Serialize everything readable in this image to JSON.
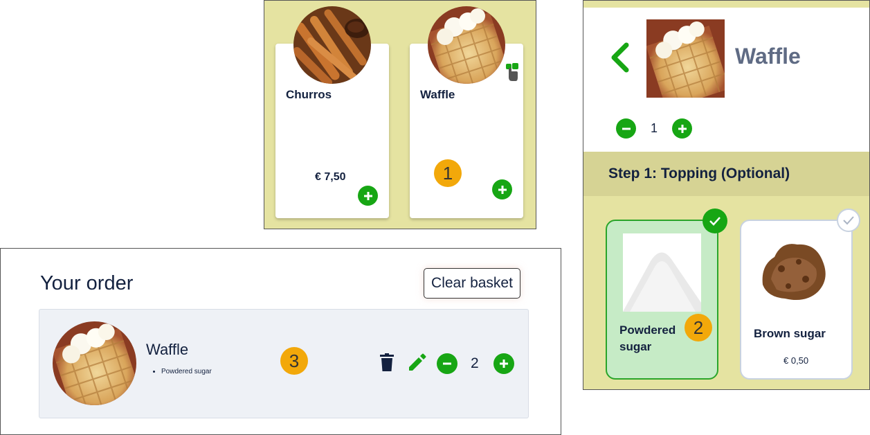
{
  "menu": {
    "items": [
      {
        "name": "Churros",
        "price": "€  7,50"
      },
      {
        "name": "Waffle",
        "price": ""
      }
    ],
    "badge": "1"
  },
  "detail": {
    "title": "Waffle",
    "quantity": "1",
    "step_label": "Step 1: Topping (Optional)",
    "toppings": [
      {
        "name_line1": "Powdered",
        "name_line2": "sugar",
        "price": "",
        "selected": true
      },
      {
        "name_line1": "Brown sugar",
        "name_line2": "",
        "price": "€ 0,50",
        "selected": false
      }
    ],
    "badge": "2"
  },
  "order": {
    "title": "Your order",
    "clear_label": "Clear basket",
    "item": {
      "name": "Waffle",
      "options": [
        "Powdered sugar"
      ],
      "quantity": "2"
    },
    "badge": "3"
  },
  "colors": {
    "accent": "#17a614",
    "panel_bg": "#e5e3a1",
    "badge": "#f2a80a",
    "text": "#13213f"
  }
}
